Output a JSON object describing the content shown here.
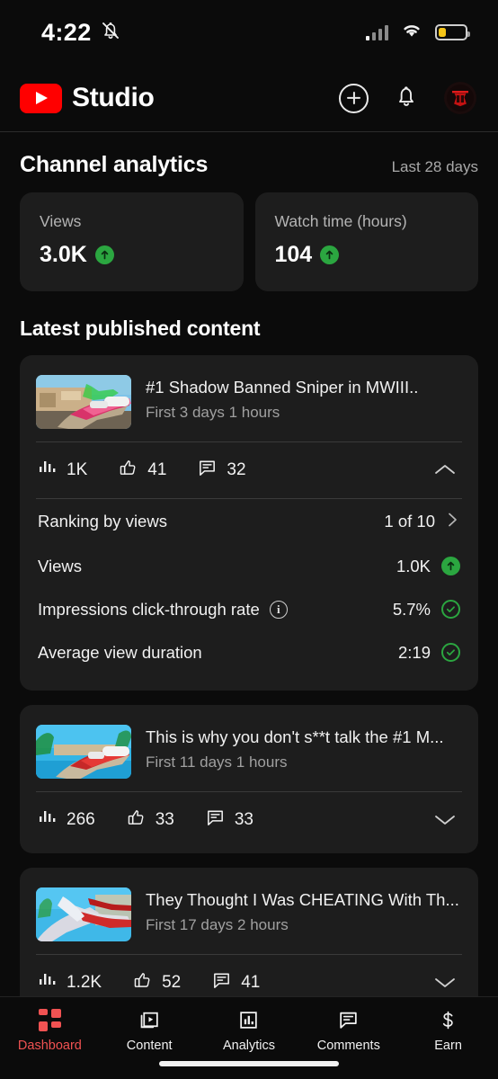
{
  "status_bar": {
    "time": "4:22",
    "mute_icon": "bell-slash-icon",
    "signal_icon": "cellular-signal-icon",
    "wifi_icon": "wifi-icon",
    "battery_icon": "battery-low-icon",
    "battery_level_percent": 28,
    "battery_color": "#f5c518"
  },
  "header": {
    "logo_icon": "youtube-logo-icon",
    "app_name": "Studio",
    "create_icon": "plus-circle-icon",
    "notifications_icon": "bell-icon",
    "avatar_icon": "channel-avatar-icon"
  },
  "analytics": {
    "title": "Channel analytics",
    "date_range": "Last 28 days",
    "cards": [
      {
        "label": "Views",
        "value": "3.0K",
        "trend": "up",
        "trend_icon": "arrow-up-icon",
        "trend_color": "#2ba640"
      },
      {
        "label": "Watch time (hours)",
        "value": "104",
        "trend": "up",
        "trend_icon": "arrow-up-icon",
        "trend_color": "#2ba640"
      }
    ]
  },
  "latest_content": {
    "title": "Latest published content",
    "videos": [
      {
        "title": "#1 Shadow Banned Sniper in MWIII..",
        "subtitle": "First 3 days 1 hours",
        "thumbnail": "sniper-rifle-building-thumbnail",
        "views": "1K",
        "likes": "41",
        "comments": "32",
        "expanded": true,
        "toggle_icon": "chevron-up-icon",
        "details": [
          {
            "label": "Ranking by views",
            "value": "1 of 10",
            "status_icon": "chevron-right-icon",
            "kind": "link"
          },
          {
            "label": "Views",
            "value": "1.0K",
            "status_icon": "arrow-up-badge-icon",
            "kind": "up"
          },
          {
            "label": "Impressions click-through rate",
            "value": "5.7%",
            "status_icon": "check-circle-icon",
            "kind": "check",
            "info_icon": "info-icon"
          },
          {
            "label": "Average view duration",
            "value": "2:19",
            "status_icon": "check-circle-icon",
            "kind": "check"
          }
        ]
      },
      {
        "title": "This is why you don't s**t talk the #1 M...",
        "subtitle": "First 11 days 1 hours",
        "thumbnail": "beach-sniper-thumbnail",
        "views": "266",
        "likes": "33",
        "comments": "33",
        "expanded": false,
        "toggle_icon": "chevron-down-icon",
        "details": []
      },
      {
        "title": "They Thought I Was CHEATING With Th...",
        "subtitle": "First 17 days 2 hours",
        "thumbnail": "white-red-weapon-thumbnail",
        "views": "1.2K",
        "likes": "52",
        "comments": "41",
        "expanded": false,
        "toggle_icon": "chevron-down-icon",
        "details": []
      }
    ],
    "stat_icons": {
      "views": "bar-chart-icon",
      "likes": "thumbs-up-icon",
      "comments": "comment-icon"
    }
  },
  "bottom_nav": {
    "active": "Dashboard",
    "active_color": "#f05252",
    "items": [
      {
        "label": "Dashboard",
        "icon": "dashboard-grid-icon"
      },
      {
        "label": "Content",
        "icon": "video-library-icon"
      },
      {
        "label": "Analytics",
        "icon": "bar-chart-icon"
      },
      {
        "label": "Comments",
        "icon": "comment-icon"
      },
      {
        "label": "Earn",
        "icon": "dollar-icon"
      }
    ]
  }
}
